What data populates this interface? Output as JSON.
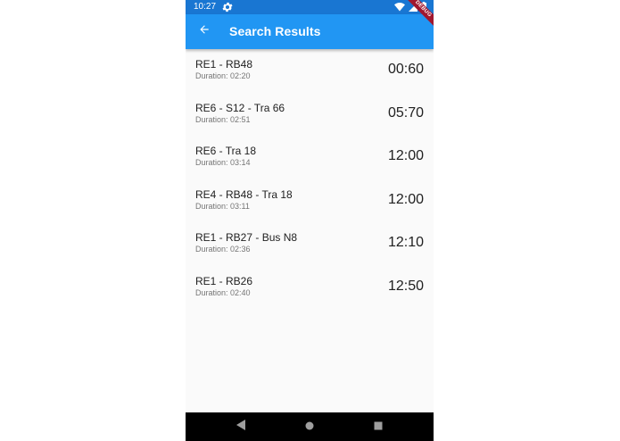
{
  "status_bar": {
    "time": "10:27",
    "icons": [
      "settings-icon",
      "wifi-icon",
      "signal-icon",
      "battery-icon"
    ]
  },
  "app_bar": {
    "title": "Search Results",
    "back_icon": "arrow-back-icon",
    "debug_banner": "DEBUG"
  },
  "colors": {
    "status_bar": "#1976d2",
    "app_bar": "#2196f3",
    "background": "#fafafa",
    "debug_banner": "#a0172f"
  },
  "results": [
    {
      "route": "RE1 - RB48",
      "duration": "Duration: 02:20",
      "time": "00:60"
    },
    {
      "route": "RE6 - S12 - Tra 66",
      "duration": "Duration: 02:51",
      "time": "05:70"
    },
    {
      "route": "RE6 - Tra 18",
      "duration": "Duration: 03:14",
      "time": "12:00"
    },
    {
      "route": "RE4 - RB48 - Tra 18",
      "duration": "Duration: 03:11",
      "time": "12:00"
    },
    {
      "route": "RE1 - RB27 - Bus N8",
      "duration": "Duration: 02:36",
      "time": "12:10"
    },
    {
      "route": "RE1 - RB26",
      "duration": "Duration: 02:40",
      "time": "12:50"
    }
  ],
  "nav_bar": {
    "buttons": [
      "back-triangle-icon",
      "home-circle-icon",
      "recents-square-icon"
    ]
  }
}
